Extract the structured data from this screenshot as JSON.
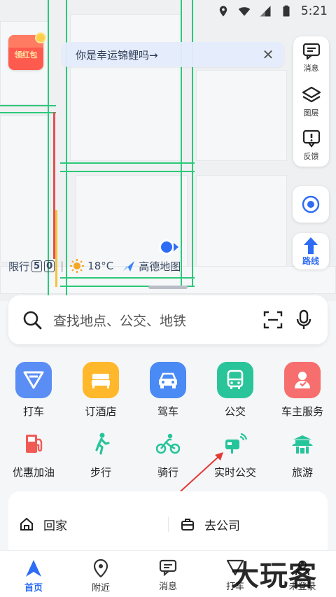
{
  "status_bar": {
    "time": "5:21"
  },
  "redpack": {
    "label": "领红包"
  },
  "banner": {
    "text": "你是幸运锦鲤吗→",
    "close": "✕"
  },
  "tools": [
    {
      "label": "消息"
    },
    {
      "label": "图层"
    },
    {
      "label": "反馈"
    }
  ],
  "route_button": {
    "label": "路线"
  },
  "map_info": {
    "restriction_label": "限行",
    "restriction_value": "5",
    "restriction_value2": "0",
    "separator": "|",
    "temperature": "18°C",
    "logo_text": "高德地图"
  },
  "search": {
    "placeholder": "查找地点、公交、地铁"
  },
  "services_row1": [
    {
      "name": "打车",
      "color": "#4f8cf6"
    },
    {
      "name": "订酒店",
      "color": "#ffb72b"
    },
    {
      "name": "驾车",
      "color": "#4a8af4"
    },
    {
      "name": "公交",
      "color": "#2ac49a"
    },
    {
      "name": "车主服务",
      "color": "#f76e6e"
    }
  ],
  "services_row2": [
    {
      "name": "优惠加油",
      "color": "#f05a55"
    },
    {
      "name": "步行",
      "color": "#26c49a"
    },
    {
      "name": "骑行",
      "color": "#26c49a"
    },
    {
      "name": "实时公交",
      "color": "#26c49a"
    },
    {
      "name": "旅游",
      "color": "#26c49a"
    }
  ],
  "quick": {
    "home": "回家",
    "work": "去公司"
  },
  "tabs": [
    {
      "label": "首页"
    },
    {
      "label": "附近"
    },
    {
      "label": "消息"
    },
    {
      "label": "打车"
    },
    {
      "label": "未登录"
    }
  ],
  "watermark": {
    "text": "大玩客"
  },
  "colors": {
    "accent": "#2e6cf6",
    "road_green": "#2cc97a",
    "road_red": "#e45050"
  }
}
